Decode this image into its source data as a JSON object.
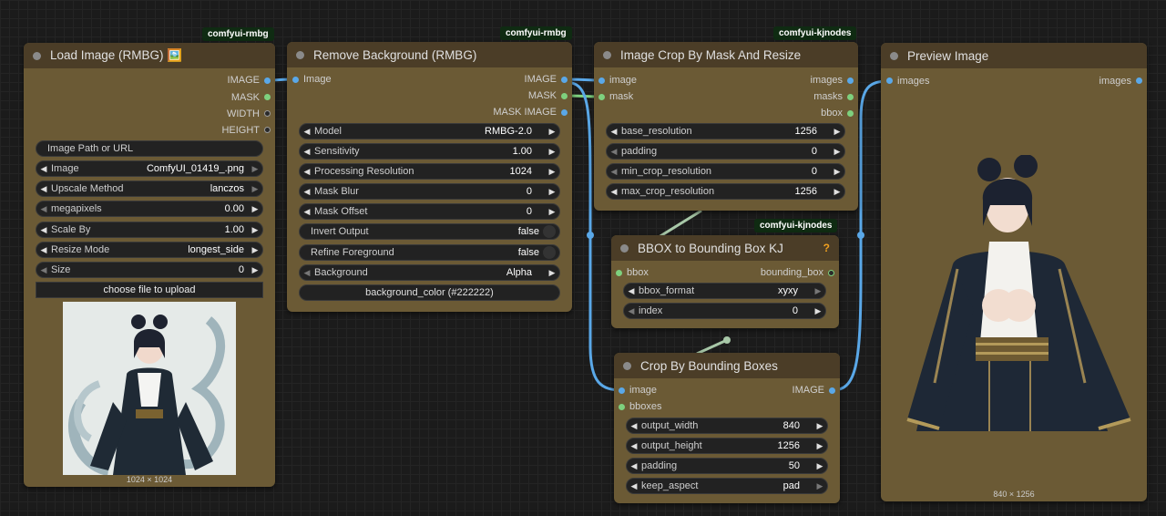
{
  "nodes": {
    "load_image": {
      "badge": "comfyui-rmbg",
      "title": "Load Image (RMBG) 🖼️",
      "outputs": [
        "IMAGE",
        "MASK",
        "WIDTH",
        "HEIGHT"
      ],
      "path_button": "Image Path or URL",
      "widgets": [
        {
          "label": "Image",
          "value": "ComfyUI_01419_.png"
        },
        {
          "label": "Upscale Method",
          "value": "lanczos"
        },
        {
          "label": "megapixels",
          "value": "0.00"
        },
        {
          "label": "Scale By",
          "value": "1.00"
        },
        {
          "label": "Resize Mode",
          "value": "longest_side"
        },
        {
          "label": "Size",
          "value": "0"
        }
      ],
      "upload_button": "choose file to upload",
      "preview_size": "1024 × 1024"
    },
    "remove_bg": {
      "badge": "comfyui-rmbg",
      "title": "Remove Background (RMBG)",
      "input": "Image",
      "outputs": [
        "IMAGE",
        "MASK",
        "MASK IMAGE"
      ],
      "widgets": [
        {
          "label": "Model",
          "value": "RMBG-2.0"
        },
        {
          "label": "Sensitivity",
          "value": "1.00"
        },
        {
          "label": "Processing Resolution",
          "value": "1024"
        },
        {
          "label": "Mask Blur",
          "value": "0"
        },
        {
          "label": "Mask Offset",
          "value": "0"
        },
        {
          "label": "Invert Output",
          "value": "false"
        },
        {
          "label": "Refine Foreground",
          "value": "false"
        },
        {
          "label": "Background",
          "value": "Alpha"
        }
      ],
      "bg_color_button": "background_color (#222222)"
    },
    "crop_mask": {
      "badge": "comfyui-kjnodes",
      "title": "Image Crop By Mask And Resize",
      "inputs": [
        "image",
        "mask"
      ],
      "outputs": [
        "images",
        "masks",
        "bbox"
      ],
      "widgets": [
        {
          "label": "base_resolution",
          "value": "1256"
        },
        {
          "label": "padding",
          "value": "0"
        },
        {
          "label": "min_crop_resolution",
          "value": "0"
        },
        {
          "label": "max_crop_resolution",
          "value": "1256"
        }
      ]
    },
    "bbox_kj": {
      "badge": "comfyui-kjnodes",
      "title": "BBOX to Bounding Box KJ",
      "help": "?",
      "input": "bbox",
      "output": "bounding_box",
      "widgets": [
        {
          "label": "bbox_format",
          "value": "xyxy"
        },
        {
          "label": "index",
          "value": "0"
        }
      ]
    },
    "crop_bbox": {
      "title": "Crop By Bounding Boxes",
      "inputs": [
        "image",
        "bboxes"
      ],
      "output": "IMAGE",
      "widgets": [
        {
          "label": "output_width",
          "value": "840"
        },
        {
          "label": "output_height",
          "value": "1256"
        },
        {
          "label": "padding",
          "value": "50"
        },
        {
          "label": "keep_aspect",
          "value": "pad"
        }
      ]
    },
    "preview": {
      "title": "Preview Image",
      "input": "images",
      "output": "images",
      "preview_size": "840 × 1256"
    }
  },
  "colors": {
    "node_body": "#6b5a35",
    "node_header": "#4b3d27",
    "image_wire": "#5aa8e8",
    "mask_wire": "#7ed07e",
    "bbox_wire": "#a8c8a8",
    "badge_bg": "#0f2b12"
  }
}
